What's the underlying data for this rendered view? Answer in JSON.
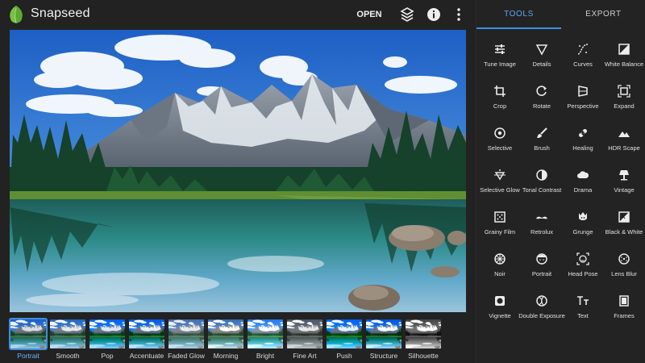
{
  "app": {
    "title": "Snapseed"
  },
  "toolbar": {
    "open_label": "OPEN"
  },
  "tabs": [
    {
      "label": "TOOLS",
      "active": true
    },
    {
      "label": "EXPORT",
      "active": false
    }
  ],
  "looks": [
    {
      "label": "Portrait",
      "active": true
    },
    {
      "label": "Smooth"
    },
    {
      "label": "Pop"
    },
    {
      "label": "Accentuate"
    },
    {
      "label": "Faded Glow"
    },
    {
      "label": "Morning"
    },
    {
      "label": "Bright"
    },
    {
      "label": "Fine Art"
    },
    {
      "label": "Push"
    },
    {
      "label": "Structure"
    },
    {
      "label": "Silhouette"
    }
  ],
  "tools": [
    {
      "label": "Tune Image",
      "icon": "tune-icon"
    },
    {
      "label": "Details",
      "icon": "details-icon"
    },
    {
      "label": "Curves",
      "icon": "curves-icon"
    },
    {
      "label": "White Balance",
      "icon": "white-balance-icon"
    },
    {
      "label": "Crop",
      "icon": "crop-icon"
    },
    {
      "label": "Rotate",
      "icon": "rotate-icon"
    },
    {
      "label": "Perspective",
      "icon": "perspective-icon"
    },
    {
      "label": "Expand",
      "icon": "expand-icon"
    },
    {
      "label": "Selective",
      "icon": "selective-icon"
    },
    {
      "label": "Brush",
      "icon": "brush-icon"
    },
    {
      "label": "Healing",
      "icon": "healing-icon"
    },
    {
      "label": "HDR Scape",
      "icon": "hdr-scape-icon"
    },
    {
      "label": "Selective Glow",
      "icon": "selective-glow-icon"
    },
    {
      "label": "Tonal Contrast",
      "icon": "tonal-contrast-icon"
    },
    {
      "label": "Drama",
      "icon": "drama-icon"
    },
    {
      "label": "Vintage",
      "icon": "vintage-icon"
    },
    {
      "label": "Grainy Film",
      "icon": "grainy-film-icon"
    },
    {
      "label": "Retrolux",
      "icon": "retrolux-icon"
    },
    {
      "label": "Grunge",
      "icon": "grunge-icon"
    },
    {
      "label": "Black & White",
      "icon": "black-white-icon"
    },
    {
      "label": "Noir",
      "icon": "noir-icon"
    },
    {
      "label": "Portrait",
      "icon": "portrait-icon"
    },
    {
      "label": "Head Pose",
      "icon": "head-pose-icon"
    },
    {
      "label": "Lens Blur",
      "icon": "lens-blur-icon"
    },
    {
      "label": "Vignette",
      "icon": "vignette-icon"
    },
    {
      "label": "Double Exposure",
      "icon": "double-exposure-icon"
    },
    {
      "label": "Text",
      "icon": "text-icon"
    },
    {
      "label": "Frames",
      "icon": "frames-icon"
    }
  ],
  "colors": {
    "accent": "#3d8fe0",
    "logo_green": "#7cc242"
  }
}
